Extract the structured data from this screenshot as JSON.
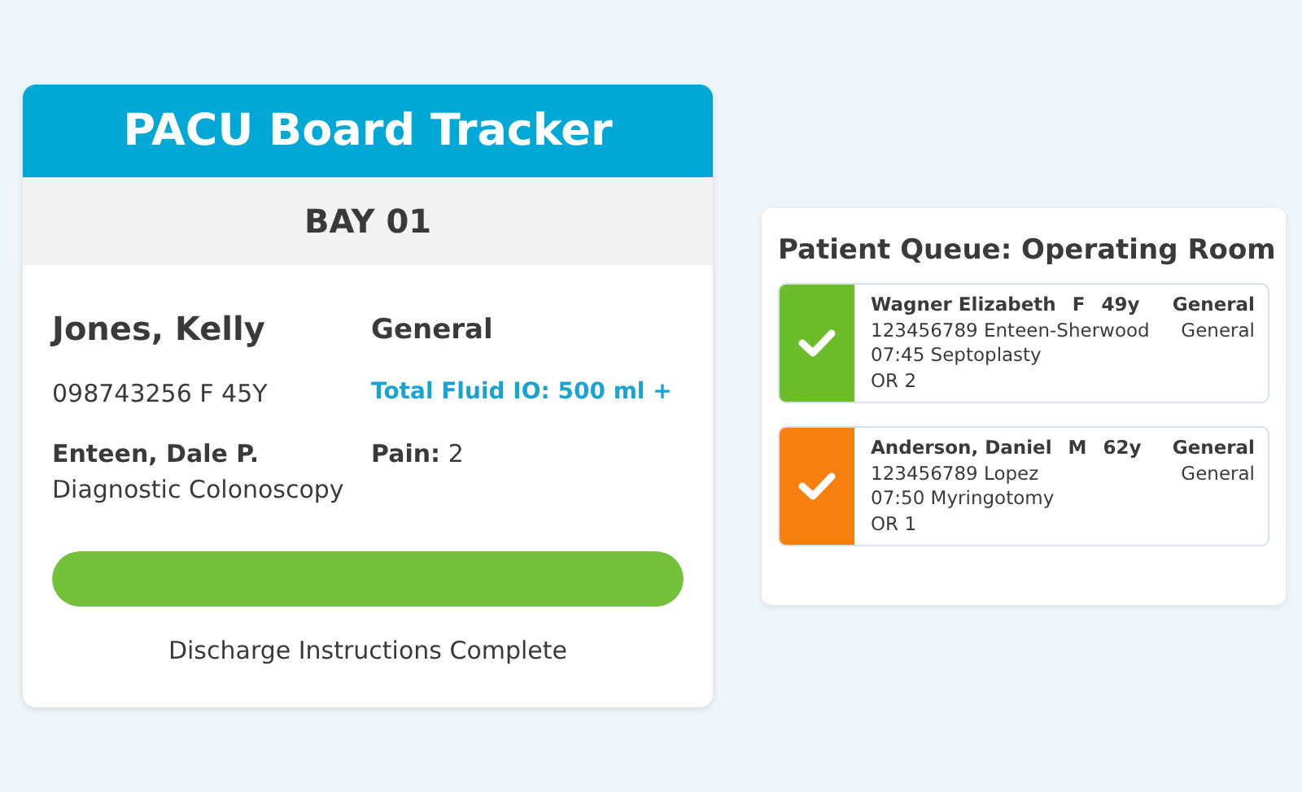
{
  "board": {
    "title": "PACU Board Tracker",
    "bay": "BAY 01",
    "patient_name": "Jones, Kelly",
    "patient_info": "098743256 F 45Y",
    "surgeon": "Enteen, Dale P.",
    "procedure": "Diagnostic Colonoscopy",
    "service": "General",
    "fluid": "Total Fluid IO: 500 ml +",
    "pain_label": "Pain:",
    "pain_value": "2",
    "progress": {
      "level": 1,
      "caption": "Discharge Instructions Complete"
    }
  },
  "queue": {
    "title": "Patient Queue: Operating Room",
    "patients": [
      {
        "name": "Wagner Elizabeth",
        "sex": "F",
        "age": "49y",
        "service": "General",
        "id_line": "123456789 Enteen-Sherwood",
        "sub_service": "General",
        "time_line": "07:45 Septoplasty",
        "room": "OR 2",
        "color": "#6cbd2a"
      },
      {
        "name": "Anderson, Daniel",
        "sex": "M",
        "age": "62y",
        "service": "General",
        "id_line": "123456789 Lopez",
        "sub_service": "General",
        "time_line": "07:50 Myringotomy",
        "room": "OR 1",
        "color": "#f77f0f"
      }
    ]
  }
}
